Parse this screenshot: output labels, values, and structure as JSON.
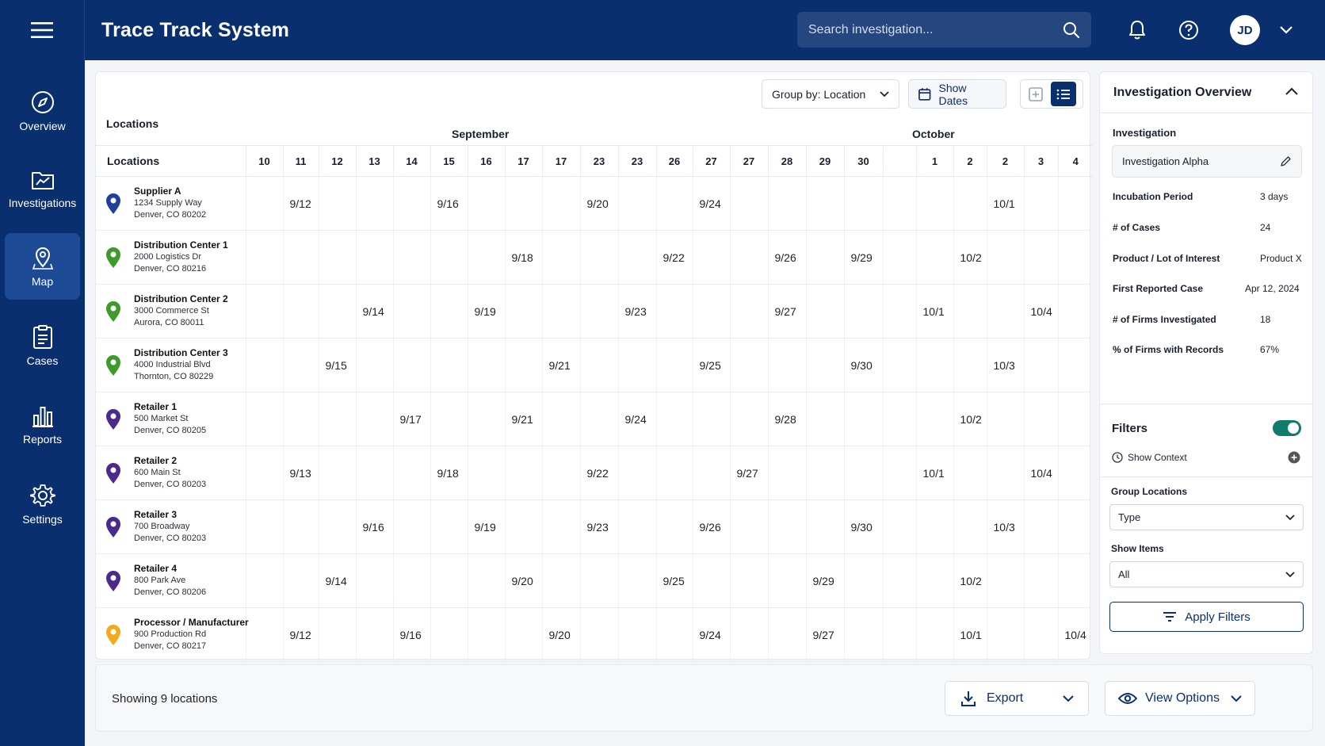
{
  "app": {
    "title": "Trace Track System",
    "user_initials": "JD"
  },
  "search": {
    "placeholder": "Search investigation..."
  },
  "sidebar": {
    "items": [
      {
        "label": "Overview"
      },
      {
        "label": "Investigations"
      },
      {
        "label": "Map"
      },
      {
        "label": "Cases"
      },
      {
        "label": "Reports"
      },
      {
        "label": "Settings"
      }
    ],
    "active": "Map"
  },
  "toolbar": {
    "group_by": "Group by: Location",
    "show_dates": "Show Dates"
  },
  "timeline": {
    "locations_heading": "Locations",
    "months": [
      "September",
      "October"
    ],
    "column_header": "Locations",
    "day_columns": [
      "10",
      "11",
      "12",
      "13",
      "14",
      "15",
      "16",
      "17",
      "17",
      "23",
      "23",
      "26",
      "27",
      "27",
      "28",
      "29",
      "30",
      "",
      "1",
      "2",
      "2",
      "3",
      "4"
    ],
    "rows": [
      {
        "name": "Supplier A",
        "addr1": "1234 Supply Way",
        "addr2": "Denver, CO 80202",
        "pin": "#1f3f9a",
        "cells": [
          "",
          "9/12",
          "",
          "",
          "",
          "9/16",
          "",
          "",
          "",
          "9/20",
          "",
          "",
          "9/24",
          "",
          "",
          "",
          "",
          "",
          "",
          "",
          "10/1",
          "",
          ""
        ]
      },
      {
        "name": "Distribution Center 1",
        "addr1": "2000 Logistics Dr",
        "addr2": "Denver, CO 80216",
        "pin": "#3f9a2c",
        "cells": [
          "",
          "",
          "",
          "",
          "",
          "",
          "",
          "9/18",
          "",
          "",
          "",
          "9/22",
          "",
          "",
          "9/26",
          "",
          "9/29",
          "",
          "",
          "10/2",
          "",
          "",
          ""
        ]
      },
      {
        "name": "Distribution Center 2",
        "addr1": "3000 Commerce St",
        "addr2": "Aurora, CO 80011",
        "pin": "#3f9a2c",
        "cells": [
          "",
          "",
          "",
          "9/14",
          "",
          "",
          "9/19",
          "",
          "",
          "",
          "9/23",
          "",
          "",
          "",
          "9/27",
          "",
          "",
          "",
          "10/1",
          "",
          "",
          "10/4",
          ""
        ]
      },
      {
        "name": "Distribution Center 3",
        "addr1": "4000 Industrial Blvd",
        "addr2": "Thornton, CO 80229",
        "pin": "#3f9a2c",
        "cells": [
          "",
          "",
          "9/15",
          "",
          "",
          "",
          "",
          "",
          "9/21",
          "",
          "",
          "",
          "9/25",
          "",
          "",
          "",
          "9/30",
          "",
          "",
          "",
          "10/3",
          "",
          ""
        ]
      },
      {
        "name": "Retailer 1",
        "addr1": "500 Market St",
        "addr2": "Denver, CO 80205",
        "pin": "#4b2a8c",
        "cells": [
          "",
          "",
          "",
          "",
          "9/17",
          "",
          "",
          "9/21",
          "",
          "",
          "9/24",
          "",
          "",
          "",
          "9/28",
          "",
          "",
          "",
          "",
          "10/2",
          "",
          "",
          ""
        ]
      },
      {
        "name": "Retailer 2",
        "addr1": "600 Main St",
        "addr2": "Denver, CO 80203",
        "pin": "#4b2a8c",
        "cells": [
          "",
          "9/13",
          "",
          "",
          "",
          "9/18",
          "",
          "",
          "",
          "9/22",
          "",
          "",
          "",
          "9/27",
          "",
          "",
          "",
          "",
          "10/1",
          "",
          "",
          "10/4",
          ""
        ]
      },
      {
        "name": "Retailer 3",
        "addr1": "700 Broadway",
        "addr2": "Denver, CO 80203",
        "pin": "#4b2a8c",
        "cells": [
          "",
          "",
          "",
          "9/16",
          "",
          "",
          "9/19",
          "",
          "",
          "9/23",
          "",
          "",
          "9/26",
          "",
          "",
          "",
          "9/30",
          "",
          "",
          "",
          "10/3",
          "",
          ""
        ]
      },
      {
        "name": "Retailer 4",
        "addr1": "800 Park Ave",
        "addr2": "Denver, CO 80206",
        "pin": "#4b2a8c",
        "cells": [
          "",
          "",
          "9/14",
          "",
          "",
          "",
          "",
          "9/20",
          "",
          "",
          "",
          "9/25",
          "",
          "",
          "",
          "9/29",
          "",
          "",
          "",
          "10/2",
          "",
          "",
          ""
        ]
      },
      {
        "name": "Processor / Manufacturer",
        "addr1": "900 Production Rd",
        "addr2": "Denver, CO 80217",
        "pin": "#f2a91c",
        "cells": [
          "",
          "9/12",
          "",
          "",
          "9/16",
          "",
          "",
          "",
          "9/20",
          "",
          "",
          "",
          "9/24",
          "",
          "",
          "9/27",
          "",
          "",
          "",
          "10/1",
          "",
          "",
          "10/4"
        ]
      }
    ]
  },
  "footer": {
    "showing": "Showing 9 locations",
    "export": "Export",
    "view_options": "View Options"
  },
  "overview": {
    "title": "Investigation Overview",
    "investigation_label": "Investigation",
    "investigation_value": "Investigation Alpha",
    "stats": [
      {
        "label": "Incubation Period",
        "value": "3 days"
      },
      {
        "label": "# of Cases",
        "value": "24"
      },
      {
        "label": "Product / Lot of Interest",
        "value": "Product X"
      },
      {
        "label": "First Reported Case",
        "value": "Apr 12, 2024"
      },
      {
        "label": "# of Firms Investigated",
        "value": "18"
      },
      {
        "label": "% of Firms with Records",
        "value": "67%"
      }
    ],
    "filters_label": "Filters",
    "show_context": "Show Context",
    "group_locations_label": "Group Locations",
    "group_locations_value": "Type",
    "show_items_label": "Show Items",
    "show_items_value": "All",
    "apply_filters": "Apply Filters"
  }
}
